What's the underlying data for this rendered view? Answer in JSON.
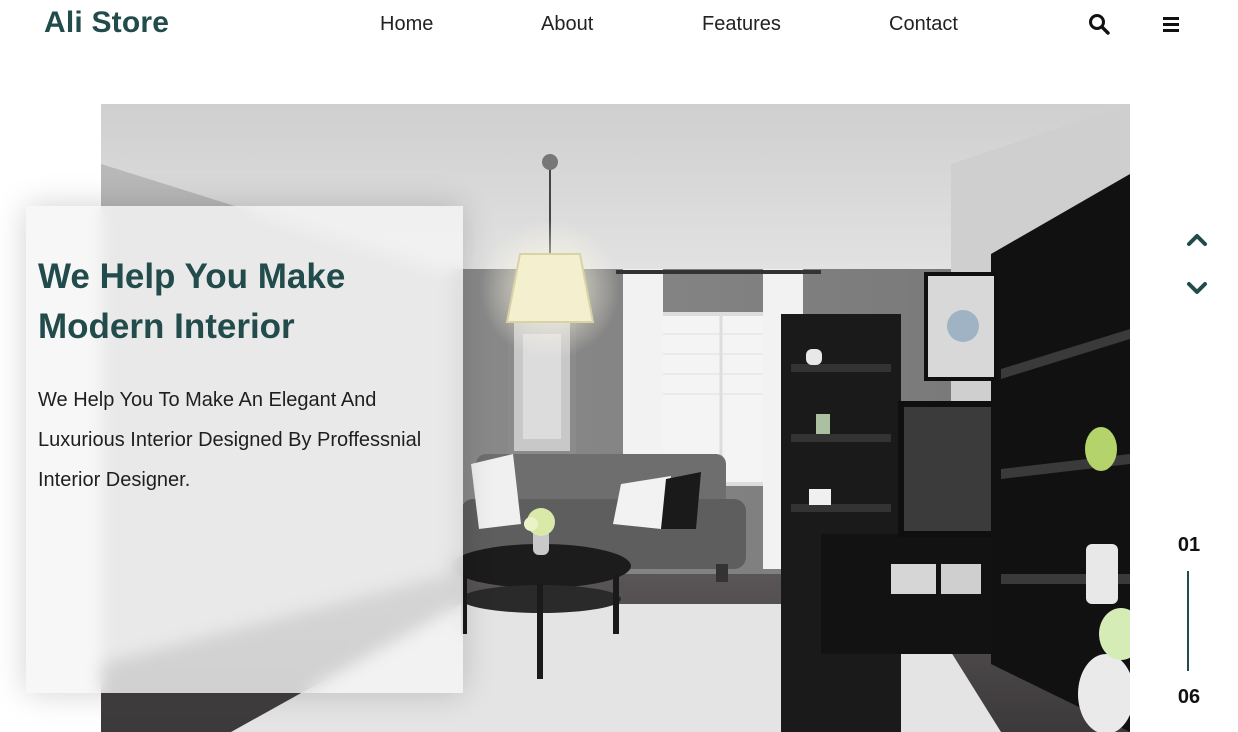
{
  "header": {
    "brand": "Ali Store",
    "nav": [
      {
        "label": "Home"
      },
      {
        "label": "About"
      },
      {
        "label": "Features"
      },
      {
        "label": "Contact"
      }
    ],
    "icons": {
      "search": "search-icon",
      "menu": "hamburger-menu-icon"
    }
  },
  "hero": {
    "image_subject": "modern living room interior",
    "title": "We Help You Make Modern Interior",
    "description": "We Help You To Make An Elegant And Luxurious Interior Designed By Proffessnial Interior Designer."
  },
  "slider": {
    "current": "01",
    "total": "06",
    "icons": {
      "prev": "chevron-up-icon",
      "next": "chevron-down-icon"
    }
  },
  "colors": {
    "brand": "#224b4b",
    "text": "#222222",
    "card_bg": "#f5f5f5"
  }
}
